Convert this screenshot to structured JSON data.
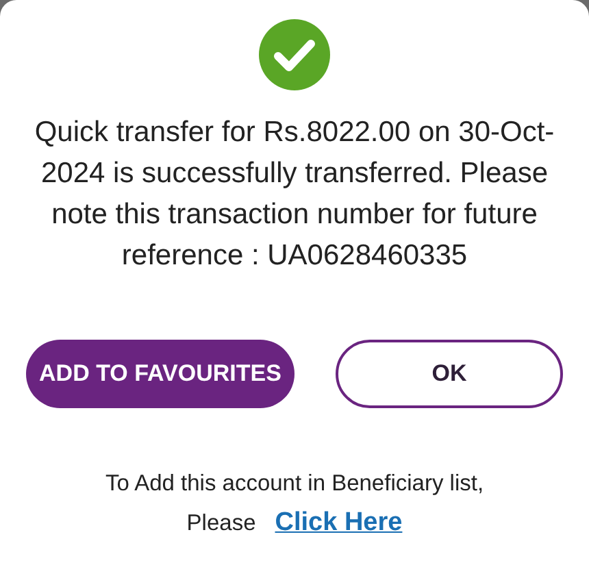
{
  "dialog": {
    "success": true,
    "message": "Quick transfer for Rs.8022.00 on 30-Oct-2024 is successfully transferred. Please note this transaction number for future reference : UA0628460335",
    "buttons": [
      {
        "label": "ADD TO FAVOURITES",
        "kind": "primary"
      },
      {
        "label": "OK",
        "kind": "secondary"
      }
    ],
    "footer": {
      "text": "To Add this account in Beneficiary list,",
      "prefix": "Please",
      "link": "Click Here"
    }
  }
}
